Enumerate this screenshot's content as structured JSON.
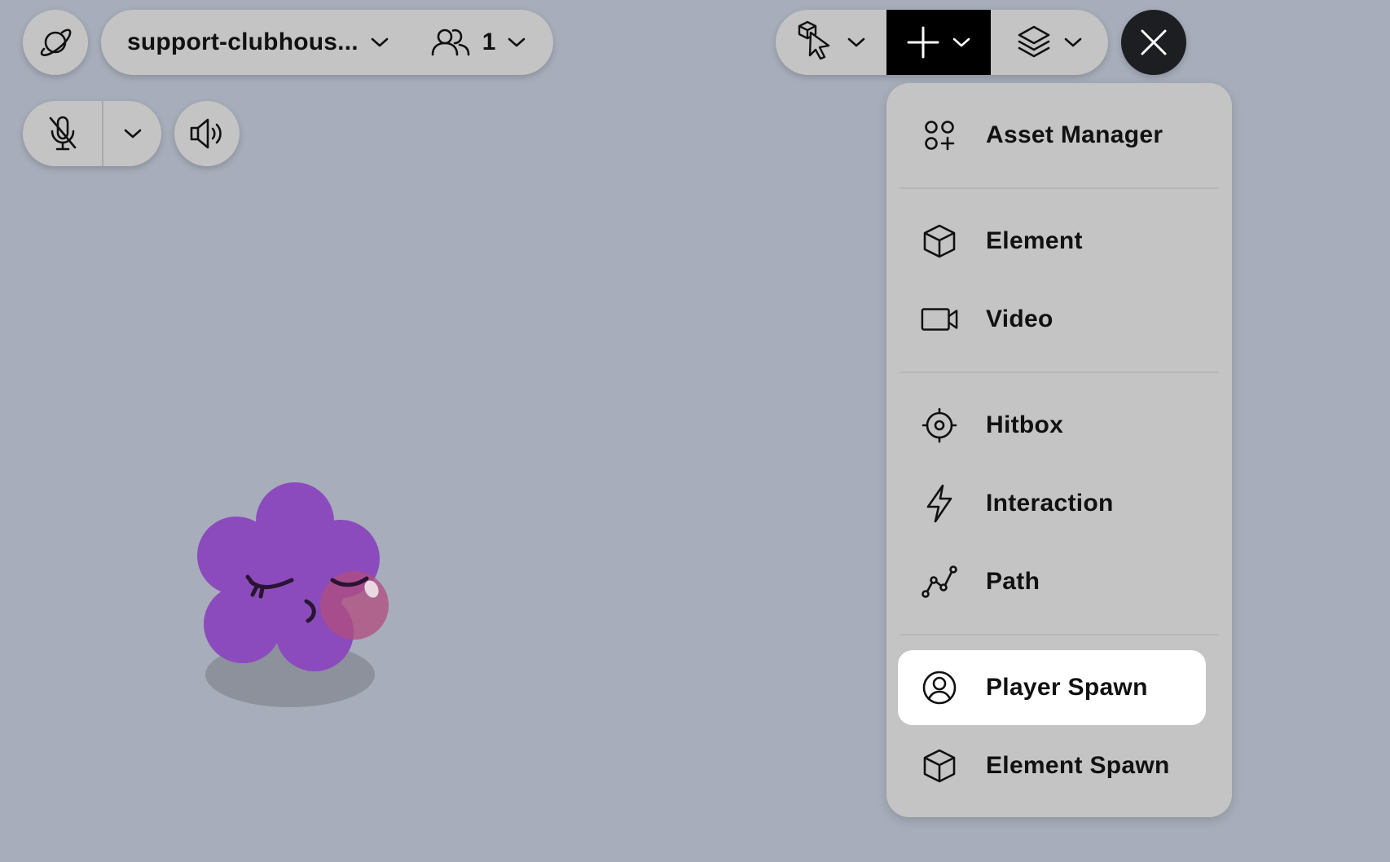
{
  "toolbar": {
    "room_name": "support-clubhous...",
    "user_count": "1"
  },
  "menu": {
    "items": [
      {
        "label": "Asset Manager",
        "icon": "asset-manager-icon"
      },
      {
        "label": "Element",
        "icon": "cube-icon"
      },
      {
        "label": "Video",
        "icon": "video-camera-icon"
      },
      {
        "label": "Hitbox",
        "icon": "target-icon"
      },
      {
        "label": "Interaction",
        "icon": "lightning-icon"
      },
      {
        "label": "Path",
        "icon": "path-icon"
      },
      {
        "label": "Player Spawn",
        "icon": "user-circle-icon",
        "selected": true
      },
      {
        "label": "Element Spawn",
        "icon": "cube-icon"
      }
    ]
  },
  "colors": {
    "background": "#a7adba",
    "panel": "#c4c4c4",
    "active_tool": "#000000",
    "close_button": "#1c1e22",
    "avatar": "#8b4bbd",
    "selected_item": "#ffffff"
  }
}
